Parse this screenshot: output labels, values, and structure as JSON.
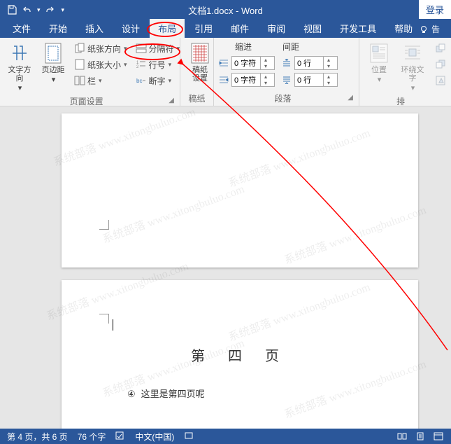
{
  "titlebar": {
    "doc_title": "文档1.docx  -  Word",
    "login": "登录"
  },
  "tabs": {
    "file": "文件",
    "home": "开始",
    "insert": "插入",
    "design": "设计",
    "layout": "布局",
    "references": "引用",
    "mailings": "邮件",
    "review": "审阅",
    "view": "视图",
    "developer": "开发工具",
    "help": "帮助",
    "tell": "告"
  },
  "ribbon": {
    "page_setup": {
      "text_direction": "文字方向",
      "margins": "页边距",
      "orientation": "纸张方向",
      "size": "纸张大小",
      "columns": "栏",
      "breaks": "分隔符",
      "line_numbers": "行号",
      "hyphenation": "断字",
      "group": "页面设置"
    },
    "manuscript": {
      "settings": "设置",
      "sub": "稿纸",
      "group": "稿纸"
    },
    "paragraph": {
      "indent_label": "缩进",
      "spacing_label": "间距",
      "indent_left": "0 字符",
      "indent_right": "0 字符",
      "space_before": "0 行",
      "space_after": "0 行",
      "group": "段落"
    },
    "arrange": {
      "position": "位置",
      "wrap": "环绕文字",
      "group": "排"
    }
  },
  "document": {
    "page_heading": "第   四   页",
    "line_marker": "④",
    "line_text": "这里是第四页呢"
  },
  "statusbar": {
    "page_info": "第 4 页，共 6 页",
    "word_count": "76 个字",
    "language": "中文(中国)"
  },
  "watermark": "系统部落 www.xitongbuluo.com"
}
